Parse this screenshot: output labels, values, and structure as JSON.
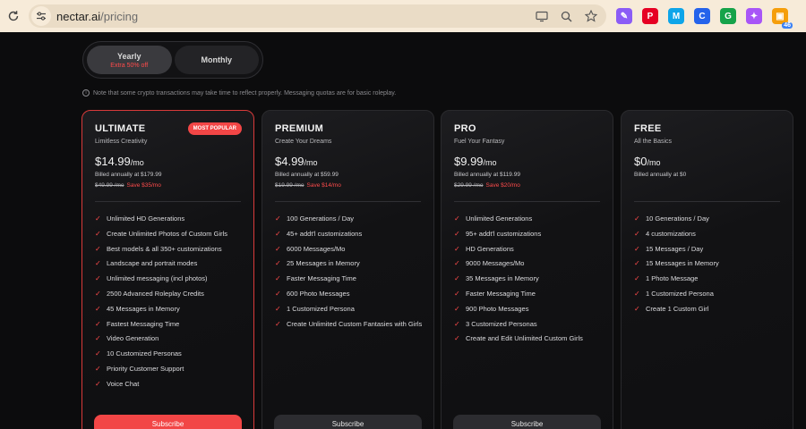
{
  "browser": {
    "url_domain": "nectar.ai",
    "url_path": "/pricing",
    "extensions": [
      {
        "icon": "feather-pen-icon",
        "color": "#8b5cf6",
        "glyph": "✎"
      },
      {
        "icon": "pinterest-icon",
        "color": "#e60023",
        "glyph": "P"
      },
      {
        "icon": "m-extension-icon",
        "color": "#0ea5e9",
        "glyph": "M"
      },
      {
        "icon": "color-picker-icon",
        "color": "#2563eb",
        "glyph": "C"
      },
      {
        "icon": "grammarly-icon",
        "color": "#16a34a",
        "glyph": "G"
      },
      {
        "icon": "puzzle-app-icon",
        "color": "#a855f7",
        "glyph": "✦"
      },
      {
        "icon": "badge-extension-icon",
        "color": "#f59e0b",
        "glyph": "▣",
        "badge": "46"
      }
    ]
  },
  "billing_toggle": {
    "yearly_label": "Yearly",
    "yearly_sub": "Extra 50% off",
    "monthly_label": "Monthly",
    "selected": "Yearly"
  },
  "note": "Note that some crypto transactions may take time to reflect properly. Messaging quotas are for basic roleplay.",
  "accent_color": "#f24646",
  "plans": [
    {
      "name": "ULTIMATE",
      "tagline": "Limitless Creativity",
      "badge": "MOST POPULAR",
      "price": "$14.99",
      "per": "/mo",
      "billed": "Billed annually at $179.99",
      "original": "$49.99 /mo",
      "save": "Save $35/mo",
      "features": [
        "Unlimited HD Generations",
        "Create Unlimited Photos of Custom Girls",
        "Best models & all 350+ customizations",
        "Landscape and portrait modes",
        "Unlimited messaging (incl photos)",
        "2500 Advanced Roleplay Credits",
        "45 Messages in Memory",
        "Fastest Messaging Time",
        "Video Generation",
        "10 Customized Personas",
        "Priority Customer Support",
        "Voice Chat"
      ],
      "button": "Subscribe"
    },
    {
      "name": "PREMIUM",
      "tagline": "Create Your Dreams",
      "price": "$4.99",
      "per": "/mo",
      "billed": "Billed annually at $59.99",
      "original": "$19.99 /mo",
      "save": "Save $14/mo",
      "features": [
        "100 Generations / Day",
        "45+ addt'l customizations",
        "6000 Messages/Mo",
        "25 Messages in Memory",
        "Faster Messaging Time",
        "600 Photo Messages",
        "1 Customized Persona",
        "Create Unlimited Custom Fantasies with Girls"
      ],
      "button": "Subscribe"
    },
    {
      "name": "PRO",
      "tagline": "Fuel Your Fantasy",
      "price": "$9.99",
      "per": "/mo",
      "billed": "Billed annually at $119.99",
      "original": "$29.99 /mo",
      "save": "Save $20/mo",
      "features": [
        "Unlimited Generations",
        "95+ addt'l customizations",
        "HD Generations",
        "9000 Messages/Mo",
        "35 Messages in Memory",
        "Faster Messaging Time",
        "900 Photo Messages",
        "3 Customized Personas",
        "Create and Edit Unlimited Custom Girls"
      ],
      "button": "Subscribe"
    },
    {
      "name": "FREE",
      "tagline": "All the Basics",
      "price": "$0",
      "per": "/mo",
      "billed": "Billed annually at $0",
      "features": [
        "10 Generations / Day",
        "4 customizations",
        "15 Messages / Day",
        "15 Messages in Memory",
        "1 Photo Message",
        "1 Customized Persona",
        "Create 1 Custom Girl"
      ]
    }
  ]
}
